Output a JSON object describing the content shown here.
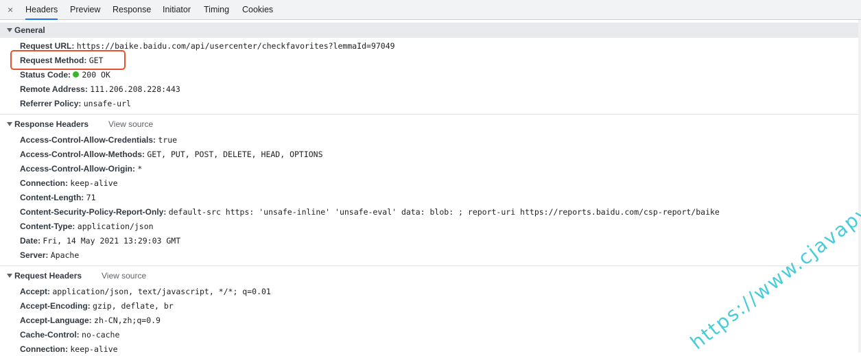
{
  "tabs": {
    "close": "×",
    "items": [
      "Headers",
      "Preview",
      "Response",
      "Initiator",
      "Timing",
      "Cookies"
    ],
    "active": "Headers"
  },
  "general": {
    "title": "General",
    "rows": [
      {
        "key": "Request URL:",
        "value": "https://baike.baidu.com/api/usercenter/checkfavorites?lemmaId=97049"
      },
      {
        "key": "Request Method:",
        "value": "GET"
      },
      {
        "key": "Status Code:",
        "value": "200 OK"
      },
      {
        "key": "Remote Address:",
        "value": "111.206.208.228:443"
      },
      {
        "key": "Referrer Policy:",
        "value": "unsafe-url"
      }
    ]
  },
  "response_headers": {
    "title": "Response Headers",
    "view_source": "View source",
    "rows": [
      {
        "key": "Access-Control-Allow-Credentials:",
        "value": "true"
      },
      {
        "key": "Access-Control-Allow-Methods:",
        "value": "GET, PUT, POST, DELETE, HEAD, OPTIONS"
      },
      {
        "key": "Access-Control-Allow-Origin:",
        "value": "*"
      },
      {
        "key": "Connection:",
        "value": "keep-alive"
      },
      {
        "key": "Content-Length:",
        "value": "71"
      },
      {
        "key": "Content-Security-Policy-Report-Only:",
        "value": "default-src https: 'unsafe-inline' 'unsafe-eval' data: blob: ; report-uri https://reports.baidu.com/csp-report/baike"
      },
      {
        "key": "Content-Type:",
        "value": "application/json"
      },
      {
        "key": "Date:",
        "value": "Fri, 14 May 2021 13:29:03 GMT"
      },
      {
        "key": "Server:",
        "value": "Apache"
      }
    ]
  },
  "request_headers": {
    "title": "Request Headers",
    "view_source": "View source",
    "rows": [
      {
        "key": "Accept:",
        "value": "application/json, text/javascript, */*; q=0.01"
      },
      {
        "key": "Accept-Encoding:",
        "value": "gzip, deflate, br"
      },
      {
        "key": "Accept-Language:",
        "value": "zh-CN,zh;q=0.9"
      },
      {
        "key": "Cache-Control:",
        "value": "no-cache"
      },
      {
        "key": "Connection:",
        "value": "keep-alive"
      }
    ]
  },
  "watermark": "https://www.cjavapy.com",
  "colors": {
    "highlight": "#e4532b",
    "status_ok": "#35b729",
    "watermark": "#35c7d8",
    "active_tab": "#1a73e8"
  }
}
